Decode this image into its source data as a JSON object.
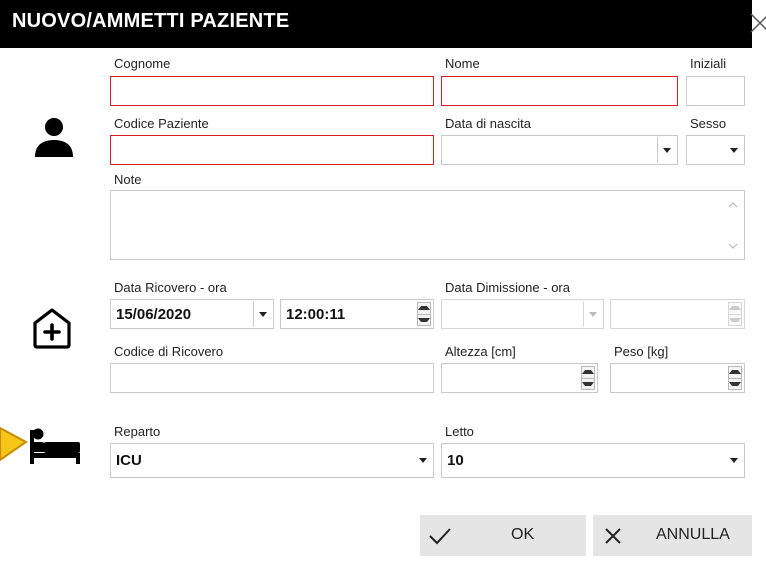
{
  "dialog": {
    "title": "NUOVO/AMMETTI PAZIENTE"
  },
  "patient": {
    "surname_label": "Cognome",
    "name_label": "Nome",
    "initials_label": "Iniziali",
    "code_label": "Codice Paziente",
    "dob_label": "Data di nascita",
    "sex_label": "Sesso",
    "notes_label": "Note"
  },
  "admission": {
    "admit_label": "Data Ricovero - ora",
    "admit_date": "15/06/2020",
    "admit_time": "12:00:11",
    "discharge_label": "Data Dimissione - ora",
    "admission_code_label": "Codice di Ricovero",
    "height_label": "Altezza [cm]",
    "weight_label": "Peso [kg]"
  },
  "location": {
    "ward_label": "Reparto",
    "ward_value": "ICU",
    "bed_label": "Letto",
    "bed_value": "10"
  },
  "buttons": {
    "ok": "OK",
    "cancel": "ANNULLA"
  },
  "colors": {
    "required_border": "#d81f1f",
    "titlebar": "#000000",
    "button_bg": "#e5e5e5",
    "warning_arrow": "#f5c518"
  },
  "icons": [
    "close-icon",
    "person-icon",
    "hospital-plus-icon",
    "bed-icon",
    "checkmark-icon",
    "cancel-x-icon",
    "warning-arrow-icon"
  ]
}
